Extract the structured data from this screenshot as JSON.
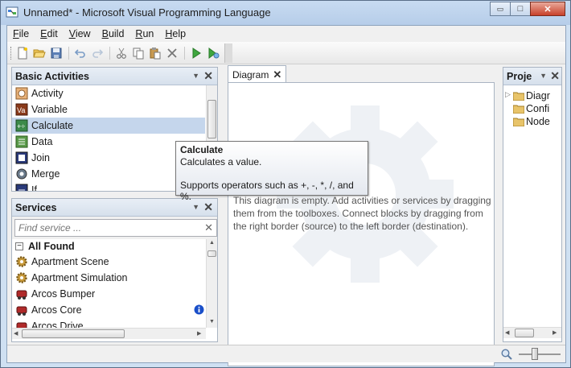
{
  "window": {
    "title": "Unnamed* - Microsoft Visual Programming Language",
    "minimize": "▭",
    "maximize": "□",
    "close": "✕"
  },
  "menu": [
    {
      "key": "F",
      "rest": "ile"
    },
    {
      "key": "E",
      "rest": "dit"
    },
    {
      "key": "V",
      "rest": "iew"
    },
    {
      "key": "B",
      "rest": "uild"
    },
    {
      "key": "R",
      "rest": "un"
    },
    {
      "key": "H",
      "rest": "elp"
    }
  ],
  "toolbar": {
    "icons": [
      "new-icon",
      "open-icon",
      "save-icon",
      "undo-icon",
      "redo-icon",
      "cut-icon",
      "copy-icon",
      "paste-icon",
      "delete-icon",
      "run-icon",
      "debug-icon"
    ]
  },
  "basic_activities": {
    "title": "Basic Activities",
    "pin": "▼",
    "close": "✕",
    "items": [
      {
        "label": "Activity",
        "icon": "activity-icon"
      },
      {
        "label": "Variable",
        "icon": "variable-icon"
      },
      {
        "label": "Calculate",
        "icon": "calculate-icon",
        "selected": true
      },
      {
        "label": "Data",
        "icon": "data-icon"
      },
      {
        "label": "Join",
        "icon": "join-icon"
      },
      {
        "label": "Merge",
        "icon": "merge-icon"
      },
      {
        "label": "If",
        "icon": "if-icon"
      }
    ]
  },
  "services": {
    "title": "Services",
    "pin": "▼",
    "close": "✕",
    "search_placeholder": "Find service ...",
    "clear": "✕",
    "group_toggle": "−",
    "group_label": "All Found",
    "items": [
      {
        "label": "Apartment Scene",
        "icon": "gear-service-icon"
      },
      {
        "label": "Apartment Simulation",
        "icon": "gear-service-icon"
      },
      {
        "label": "Arcos Bumper",
        "icon": "robot-icon"
      },
      {
        "label": "Arcos Core",
        "icon": "robot-icon",
        "info": true
      },
      {
        "label": "Arcos Drive",
        "icon": "robot-icon"
      }
    ]
  },
  "diagram": {
    "tab_label": "Diagram",
    "tab_close": "✕",
    "empty_message": "This diagram is empty. Add activities or services by dragging them from the toolboxes. Connect blocks by dragging from the right border (source) to the left border (destination)."
  },
  "tooltip": {
    "title": "Calculate",
    "description": "Calculates a value.",
    "detail": "Supports operators such as +, -, *, /, and %."
  },
  "project": {
    "title": "Proje",
    "pin": "▼",
    "close": "✕",
    "items": [
      {
        "label": "Diagr",
        "expander": "▷"
      },
      {
        "label": "Confi",
        "expander": ""
      },
      {
        "label": "Node",
        "expander": ""
      }
    ]
  },
  "colors": {
    "selection": "#c5d6ec",
    "titlebar": "#b6cde9",
    "info_badge": "#1a4fc9"
  }
}
